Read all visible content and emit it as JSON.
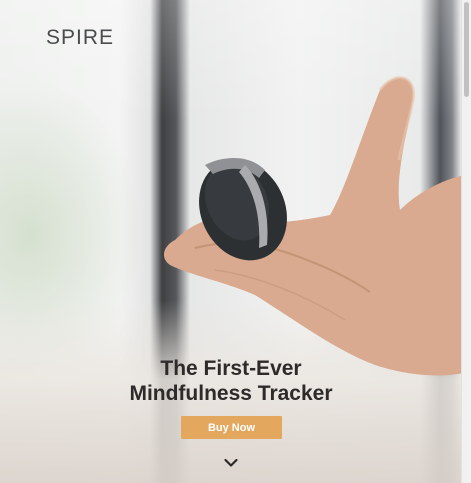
{
  "brand": {
    "logo_text": "SPIRE"
  },
  "hero": {
    "headline_line1": "The First-Ever",
    "headline_line2": "Mindfulness Tracker",
    "cta_label": "Buy Now",
    "scroll_icon": "chevron-down-icon",
    "image": "hand-holding-spire-tracker"
  },
  "colors": {
    "cta": "#e3a75e",
    "headline": "#2d2a2a",
    "logo": "#4a4b4d"
  }
}
